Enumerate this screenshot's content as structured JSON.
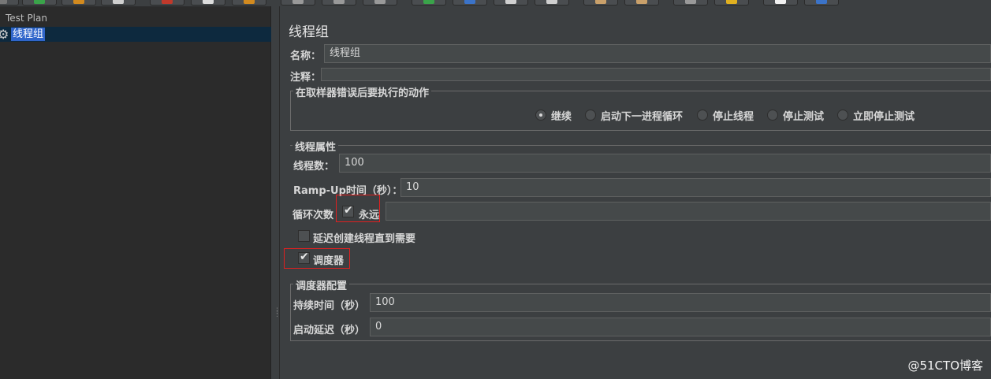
{
  "tree": {
    "root": "Test Plan",
    "selected": "线程组"
  },
  "panel": {
    "title": "线程组",
    "name_label": "名称：",
    "name_value": "线程组",
    "comment_label": "注释：",
    "comment_value": "",
    "sampler_error_group": {
      "title": "在取样器错误后要执行的动作",
      "options": [
        "继续",
        "启动下一进程循环",
        "停止线程",
        "停止测试",
        "立即停止测试"
      ],
      "selected": "继续"
    },
    "thread_props": {
      "title": "线程属性",
      "threads_label": "线程数：",
      "threads_value": "100",
      "rampup_label": "Ramp-Up时间（秒）：",
      "rampup_value": "10",
      "loop_label": "循环次数",
      "forever_label": "永远",
      "forever_checked": true,
      "loop_value": "",
      "delay_label": "延迟创建线程直到需要",
      "delay_checked": false,
      "scheduler_label": "调度器",
      "scheduler_checked": true
    },
    "scheduler_config": {
      "title": "调度器配置",
      "duration_label": "持续时间（秒）",
      "duration_value": "100",
      "startup_delay_label": "启动延迟（秒）",
      "startup_delay_value": "0"
    }
  },
  "watermark": "@51CTO博客",
  "colors": {
    "background": "#3c3f41",
    "tree_background": "#2b2b2b",
    "selection": "#2f65ca",
    "highlight_box": "#e02020"
  }
}
